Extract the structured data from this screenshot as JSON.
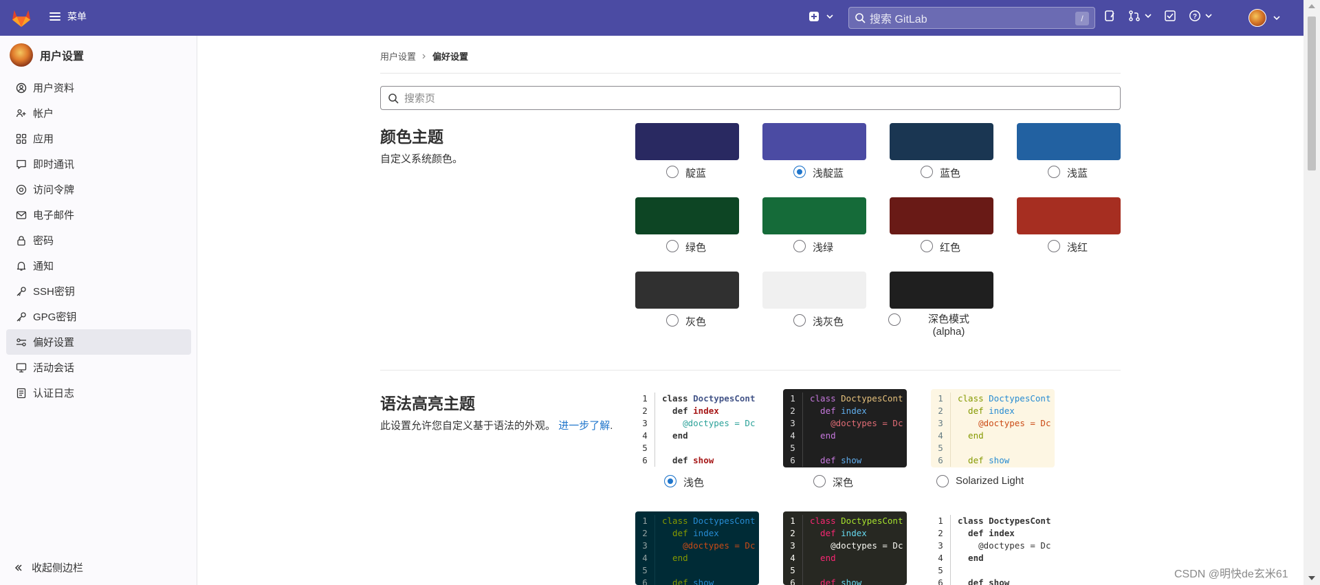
{
  "topbar": {
    "menu_label": "菜单",
    "search_placeholder": "搜索 GitLab",
    "search_shortcut": "/",
    "bg_color": "#4b4ba3"
  },
  "sidebar": {
    "title": "用户设置",
    "items": [
      {
        "label": "用户资料",
        "icon": "profile-icon"
      },
      {
        "label": "帐户",
        "icon": "account-icon"
      },
      {
        "label": "应用",
        "icon": "applications-icon"
      },
      {
        "label": "即时通讯",
        "icon": "chat-icon"
      },
      {
        "label": "访问令牌",
        "icon": "token-icon"
      },
      {
        "label": "电子邮件",
        "icon": "mail-icon"
      },
      {
        "label": "密码",
        "icon": "lock-icon"
      },
      {
        "label": "通知",
        "icon": "bell-icon"
      },
      {
        "label": "SSH密钥",
        "icon": "key-icon"
      },
      {
        "label": "GPG密钥",
        "icon": "key-icon"
      },
      {
        "label": "偏好设置",
        "icon": "preferences-icon",
        "active": true
      },
      {
        "label": "活动会话",
        "icon": "monitor-icon"
      },
      {
        "label": "认证日志",
        "icon": "log-icon"
      }
    ],
    "collapse_label": "收起侧边栏"
  },
  "breadcrumb": {
    "parent": "用户设置",
    "current": "偏好设置"
  },
  "page_search": {
    "placeholder": "搜索页"
  },
  "color_theme": {
    "title": "颜色主题",
    "description": "自定义系统颜色。",
    "themes": [
      {
        "label": "靛蓝",
        "color": "#292961",
        "selected": false
      },
      {
        "label": "浅靛蓝",
        "color": "#4b4ba3",
        "selected": true
      },
      {
        "label": "蓝色",
        "color": "#1a3652",
        "selected": false
      },
      {
        "label": "浅蓝",
        "color": "#2261a1",
        "selected": false
      },
      {
        "label": "绿色",
        "color": "#0d4524",
        "selected": false
      },
      {
        "label": "浅绿",
        "color": "#156b39",
        "selected": false
      },
      {
        "label": "红色",
        "color": "#691a16",
        "selected": false
      },
      {
        "label": "浅红",
        "color": "#a62e21",
        "selected": false
      },
      {
        "label": "灰色",
        "color": "#303030",
        "selected": false
      },
      {
        "label": "浅灰色",
        "color": "#f0f0f0",
        "selected": false
      },
      {
        "label": "深色模式",
        "label2": "(alpha)",
        "color": "#1f1f1f",
        "selected": false
      }
    ]
  },
  "syntax_theme": {
    "title": "语法高亮主题",
    "description": "此设置允许您自定义基于语法的外观。",
    "learn_more": "进一步了解",
    "period": ".",
    "themes": [
      {
        "label": "浅色",
        "selected": true
      },
      {
        "label": "深色",
        "selected": false
      },
      {
        "label": "Solarized Light",
        "selected": false
      }
    ],
    "code_lines": [
      {
        "n": "1",
        "kw": "class ",
        "name": "DoctypesCont"
      },
      {
        "n": "2",
        "kw": "  def ",
        "name": "index"
      },
      {
        "n": "3",
        "kw": "    ",
        "name": "@doctypes = Dc"
      },
      {
        "n": "4",
        "kw": "  end",
        "name": ""
      },
      {
        "n": "5",
        "kw": "",
        "name": ""
      },
      {
        "n": "6",
        "kw": "  def ",
        "name": "show"
      }
    ]
  },
  "watermark": "CSDN @明快de玄米61"
}
